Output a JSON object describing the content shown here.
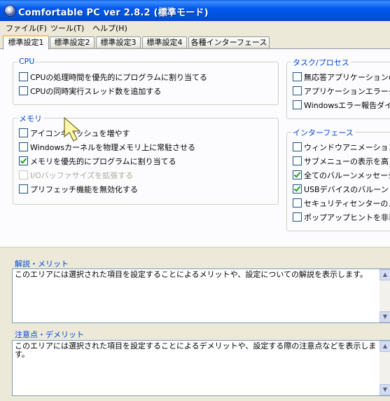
{
  "window": {
    "title": "Comfortable PC ver 2.8.2 (標準モード)"
  },
  "menu": {
    "file": "ファイル(F)",
    "tools": "ツール(T)",
    "help": "ヘルプ(H)"
  },
  "tabs": [
    "標準設定1",
    "標準設定2",
    "標準設定3",
    "標準設定4",
    "各種インターフェース"
  ],
  "active_tab": "標準設定1",
  "groups": {
    "cpu": {
      "label": "CPU",
      "items": [
        {
          "label": "CPUの処理時間を優先的にプログラムに割り当てる",
          "checked": false
        },
        {
          "label": "CPUの同時実行スレッド数を追加する",
          "checked": false
        }
      ]
    },
    "memory": {
      "label": "メモリ",
      "items": [
        {
          "label": "アイコンキャッシュを増やす",
          "checked": false
        },
        {
          "label": "Windowsカーネルを物理メモリ上に常駐させる",
          "checked": false
        },
        {
          "label": "メモリを優先的にプログラムに割り当てる",
          "checked": true
        },
        {
          "label": "I/Oバッファサイズを拡張する",
          "checked": false,
          "disabled": true
        },
        {
          "label": "プリフェッチ機能を無効化する",
          "checked": false
        }
      ]
    },
    "task": {
      "label": "タスク/プロセス",
      "items": [
        {
          "label": "無応答アプリケーションの",
          "checked": false
        },
        {
          "label": "アプリケーションエラーダ",
          "checked": false
        },
        {
          "label": "Windowsエラー報告ダイ",
          "checked": false
        }
      ]
    },
    "interface": {
      "label": "インターフェース",
      "items": [
        {
          "label": "ウィンドウアニメーションを",
          "checked": false
        },
        {
          "label": "サブメニューの表示を高",
          "checked": false
        },
        {
          "label": "全てのバルーンメッセージ",
          "checked": true
        },
        {
          "label": "USBデバイスのバルーン",
          "checked": true
        },
        {
          "label": "セキュリティセンターのメ",
          "checked": false
        },
        {
          "label": "ポップアップヒントを非表",
          "checked": false
        }
      ]
    }
  },
  "merit": {
    "label": "解説・メリット",
    "text": "このエリアには選択された項目を設定することによるメリットや、設定についての解説を表示します。"
  },
  "demerit": {
    "label": "注意点・デメリット",
    "text": "このエリアには選択された項目を設定することによるデメリットや、設定する際の注意点などを表示します。"
  }
}
